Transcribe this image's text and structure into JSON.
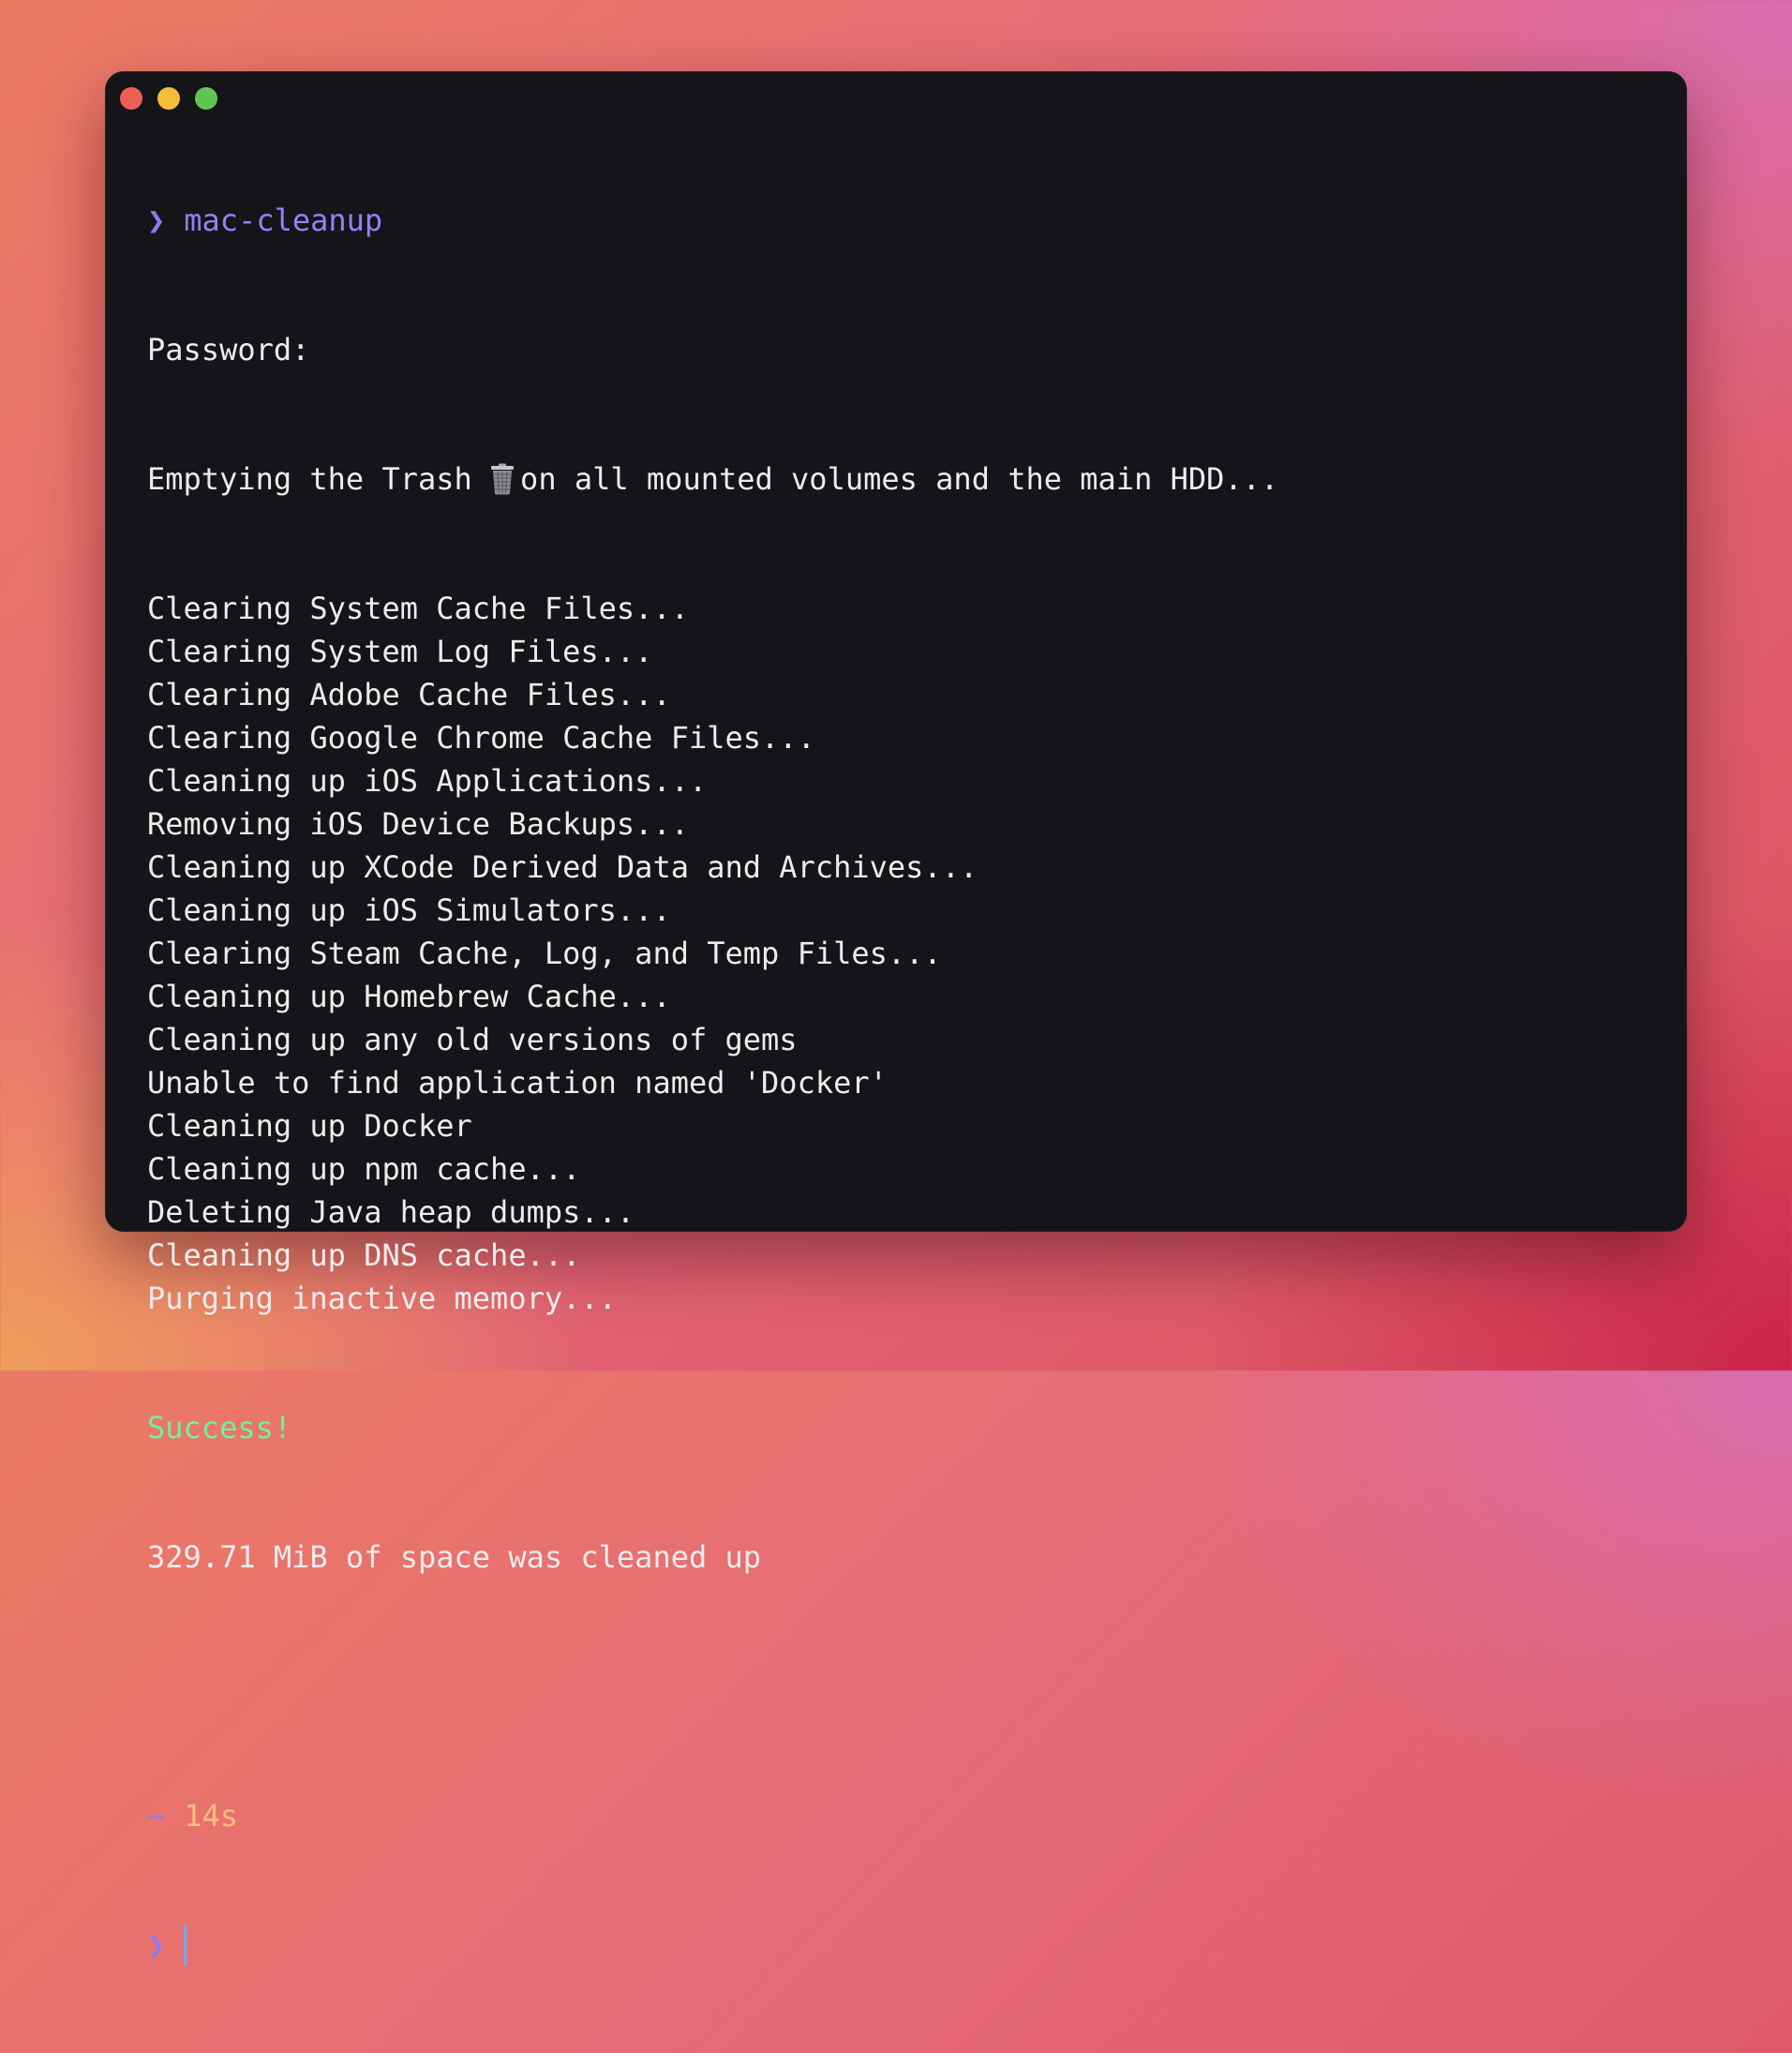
{
  "window": {
    "controls": [
      "close",
      "minimize",
      "maximize"
    ]
  },
  "prompt": {
    "symbol": "❯",
    "command": "mac-cleanup"
  },
  "output": {
    "password": "Password:",
    "trash_before": "Emptying the Trash ",
    "trash_icon": "wastebasket-icon",
    "trash_after": "on all mounted volumes and the main HDD...",
    "lines": [
      "Clearing System Cache Files...",
      "Clearing System Log Files...",
      "Clearing Adobe Cache Files...",
      "Clearing Google Chrome Cache Files...",
      "Cleaning up iOS Applications...",
      "Removing iOS Device Backups...",
      "Cleaning up XCode Derived Data and Archives...",
      "Cleaning up iOS Simulators...",
      "Clearing Steam Cache, Log, and Temp Files...",
      "Cleaning up Homebrew Cache...",
      "Cleaning up any old versions of gems",
      "Unable to find application named 'Docker'",
      "Cleaning up Docker",
      "Cleaning up npm cache...",
      "Deleting Java heap dumps...",
      "Cleaning up DNS cache...",
      "Purging inactive memory..."
    ],
    "success": "Success!",
    "summary": "329.71 MiB of space was cleaned up"
  },
  "status": {
    "directory": "~",
    "duration": "14s"
  },
  "colors": {
    "background": "#151519",
    "text": "#ececec",
    "prompt": "#8a7cf0",
    "success": "#6ef0a8",
    "duration": "#f3c07a",
    "cursor": "#5fb0ff"
  }
}
